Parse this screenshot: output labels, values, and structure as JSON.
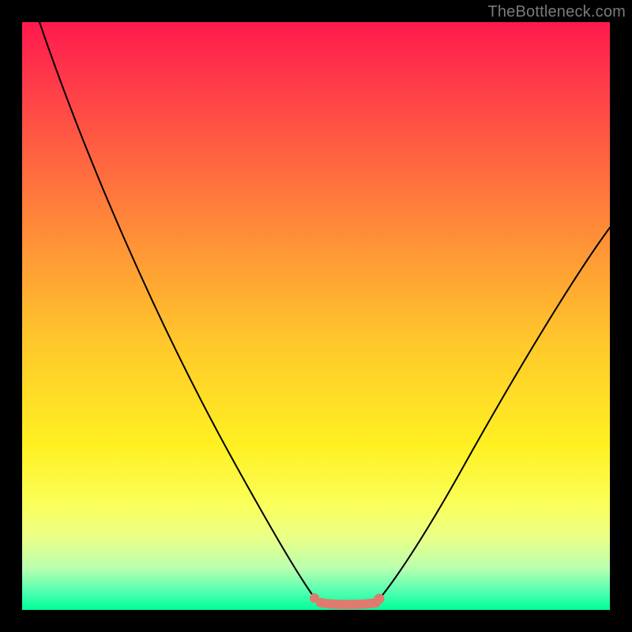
{
  "watermark": "TheBottleneck.com",
  "colors": {
    "page_bg": "#000000",
    "gradient_top": "#ff1a4d",
    "gradient_bottom": "#00ff99",
    "curve": "#000000",
    "flat_segment": "#e07a6f"
  },
  "chart_data": {
    "type": "line",
    "title": "",
    "xlabel": "",
    "ylabel": "",
    "xlim": [
      0,
      100
    ],
    "ylim": [
      0,
      100
    ],
    "note": "No axes or tick labels are rendered in the image; x is a normalized horizontal position left→right, y is vertical with 0 at bottom (green) and 100 at top (red). Values are estimated from pixel positions.",
    "series": [
      {
        "name": "left-branch",
        "x": [
          3,
          10,
          20,
          30,
          40,
          46,
          50
        ],
        "values": [
          100,
          85,
          62,
          40,
          18,
          5,
          1
        ]
      },
      {
        "name": "right-branch",
        "x": [
          60,
          66,
          75,
          85,
          95,
          100
        ],
        "values": [
          1,
          6,
          20,
          38,
          56,
          65
        ]
      },
      {
        "name": "bottom-flat-segment",
        "x": [
          50,
          53,
          56,
          60
        ],
        "values": [
          1,
          1,
          1,
          1
        ]
      }
    ],
    "annotations": []
  }
}
